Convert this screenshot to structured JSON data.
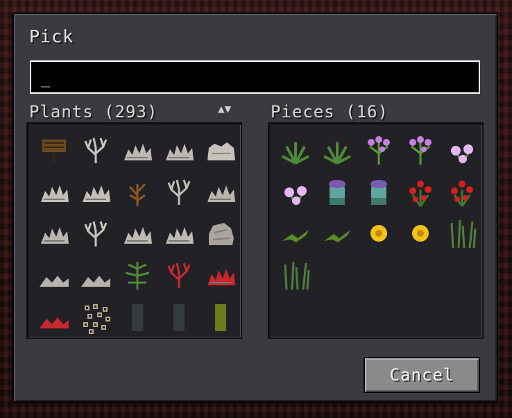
{
  "dialog": {
    "title": "Pick",
    "search_value": "_",
    "cancel_label": "Cancel"
  },
  "left": {
    "header": "Plants (293)",
    "sort_label": "▲▼",
    "items": [
      {
        "name": "sign-icon",
        "kind": "sign"
      },
      {
        "name": "dead-coral-icon",
        "kind": "coral",
        "color": "#c9c5bf"
      },
      {
        "name": "dead-coral-fan-icon",
        "kind": "fan",
        "color": "#bdb8b1"
      },
      {
        "name": "dead-coral-fan-icon",
        "kind": "fan",
        "color": "#bdb8b1"
      },
      {
        "name": "dead-coral-block-icon",
        "kind": "bush",
        "color": "#c6c1b9"
      },
      {
        "name": "dead-coral-fan-icon",
        "kind": "fan",
        "color": "#c4c0b8"
      },
      {
        "name": "dead-coral-fan-icon",
        "kind": "fan",
        "color": "#c4c0b8"
      },
      {
        "name": "dead-bush-icon",
        "kind": "deadbush",
        "color": "#8a5a22"
      },
      {
        "name": "dead-coral-icon",
        "kind": "coral",
        "color": "#c2bdb5"
      },
      {
        "name": "dead-coral-fan-icon",
        "kind": "fan",
        "color": "#b9b4ac"
      },
      {
        "name": "dead-coral-fan-icon",
        "kind": "fan",
        "color": "#b9b4ac"
      },
      {
        "name": "dead-coral-icon",
        "kind": "coral",
        "color": "#c8c4bc"
      },
      {
        "name": "dead-coral-fan-icon",
        "kind": "fan",
        "color": "#bfbab2"
      },
      {
        "name": "dead-coral-fan-icon",
        "kind": "fan",
        "color": "#bfbab2"
      },
      {
        "name": "dead-coral-block-icon",
        "kind": "rock",
        "color": "#a9a59e"
      },
      {
        "name": "dead-coral-fan-icon",
        "kind": "lowfan",
        "color": "#b6b1aa"
      },
      {
        "name": "dead-coral-fan-icon",
        "kind": "lowfan",
        "color": "#b6b1aa"
      },
      {
        "name": "fern-icon",
        "kind": "fern",
        "color": "#4f8a3a"
      },
      {
        "name": "fire-coral-icon",
        "kind": "coral",
        "color": "#c8282e"
      },
      {
        "name": "fire-coral-fan-icon",
        "kind": "fan",
        "color": "#c8282e"
      },
      {
        "name": "fire-coral-fan-icon",
        "kind": "lowfan",
        "color": "#c8282e"
      },
      {
        "name": "seeds-icon",
        "kind": "seeds",
        "color": "#6a5f55"
      },
      {
        "name": "banner-icon",
        "kind": "banner",
        "color": "#353b3c"
      },
      {
        "name": "banner-icon",
        "kind": "banner",
        "color": "#353b3c"
      },
      {
        "name": "banner-icon",
        "kind": "banner",
        "color": "#6a7a1e"
      }
    ]
  },
  "right": {
    "header": "Pieces (16)",
    "items": [
      {
        "name": "grass-tuft-icon",
        "kind": "tuft",
        "color": "#4f8a3a"
      },
      {
        "name": "grass-tuft-icon",
        "kind": "tuft",
        "color": "#4f8a3a"
      },
      {
        "name": "lilac-icon",
        "kind": "lilac",
        "color": "#c77fe0"
      },
      {
        "name": "lilac-icon",
        "kind": "lilac",
        "color": "#c77fe0"
      },
      {
        "name": "pink-flower-icon",
        "kind": "blossom",
        "color": "#e6b6f0"
      },
      {
        "name": "pink-flower-icon",
        "kind": "blossom",
        "color": "#e6b6f0"
      },
      {
        "name": "pitcher-plant-icon",
        "kind": "pitcher",
        "color": "#7a5ab0"
      },
      {
        "name": "pitcher-plant-icon",
        "kind": "pitcher",
        "color": "#7a5ab0"
      },
      {
        "name": "rose-bush-icon",
        "kind": "rose",
        "color": "#d42020"
      },
      {
        "name": "rose-bush-icon",
        "kind": "rose",
        "color": "#d42020"
      },
      {
        "name": "lily-pad-icon",
        "kind": "lily",
        "color": "#5a8a28"
      },
      {
        "name": "lily-pad-icon",
        "kind": "lily",
        "color": "#5a8a28"
      },
      {
        "name": "sunflower-icon",
        "kind": "sun",
        "color": "#f2c21a"
      },
      {
        "name": "sunflower-icon",
        "kind": "sun",
        "color": "#f2c21a"
      },
      {
        "name": "tall-grass-icon",
        "kind": "tallgrass",
        "color": "#4f7f3a"
      },
      {
        "name": "tall-grass-icon",
        "kind": "tallgrass",
        "color": "#4f7f3a"
      }
    ]
  }
}
